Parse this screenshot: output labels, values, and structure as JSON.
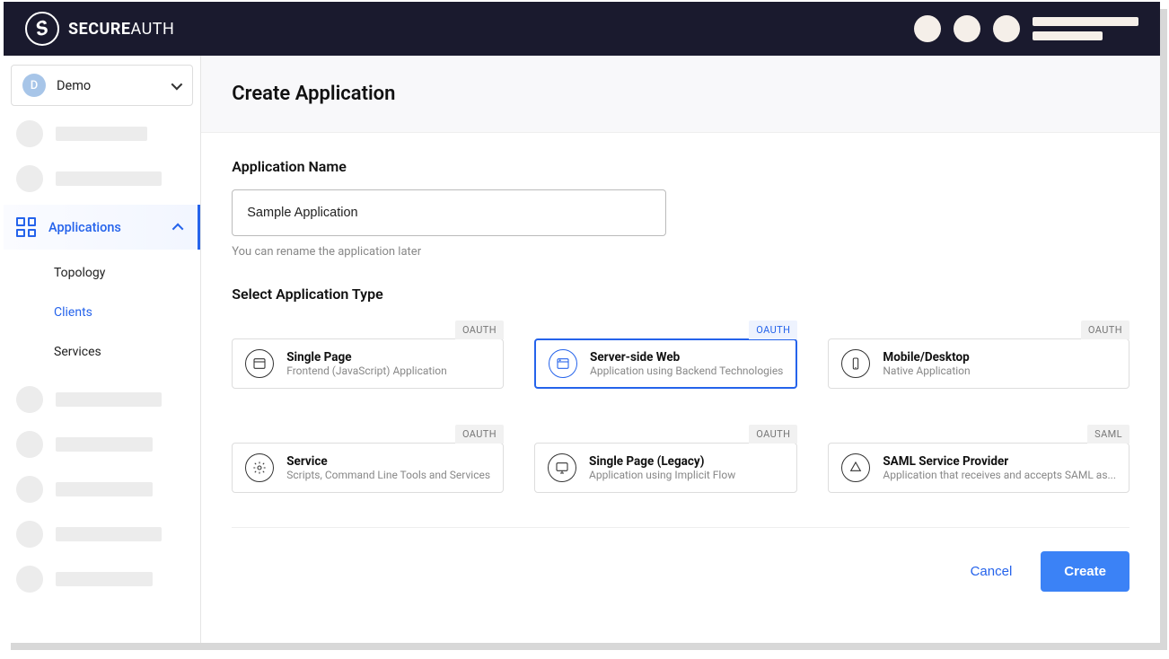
{
  "header": {
    "brand_bold": "SECURE",
    "brand_thin": "AUTH"
  },
  "sidebar": {
    "workspace_initial": "D",
    "workspace_name": "Demo",
    "applications_label": "Applications",
    "subnav": {
      "topology": "Topology",
      "clients": "Clients",
      "services": "Services"
    }
  },
  "page": {
    "title": "Create Application",
    "name_section_label": "Application Name",
    "name_value": "Sample Application",
    "name_helper": "You can rename the application later",
    "type_section_label": "Select Application Type"
  },
  "app_types": {
    "spa": {
      "badge": "OAUTH",
      "title": "Single Page",
      "sub": "Frontend (JavaScript) Application",
      "selected": false
    },
    "server": {
      "badge": "OAUTH",
      "title": "Server-side Web",
      "sub": "Application using Backend Technologies",
      "selected": true
    },
    "mobile": {
      "badge": "OAUTH",
      "title": "Mobile/Desktop",
      "sub": "Native Application",
      "selected": false
    },
    "service": {
      "badge": "OAUTH",
      "title": "Service",
      "sub": "Scripts, Command Line Tools and Services",
      "selected": false
    },
    "legacy": {
      "badge": "OAUTH",
      "title": "Single Page (Legacy)",
      "sub": "Application using Implicit Flow",
      "selected": false
    },
    "saml": {
      "badge": "SAML",
      "title": "SAML Service Provider",
      "sub": "Application that receives and accepts SAML as...",
      "selected": false
    }
  },
  "actions": {
    "cancel": "Cancel",
    "create": "Create"
  }
}
